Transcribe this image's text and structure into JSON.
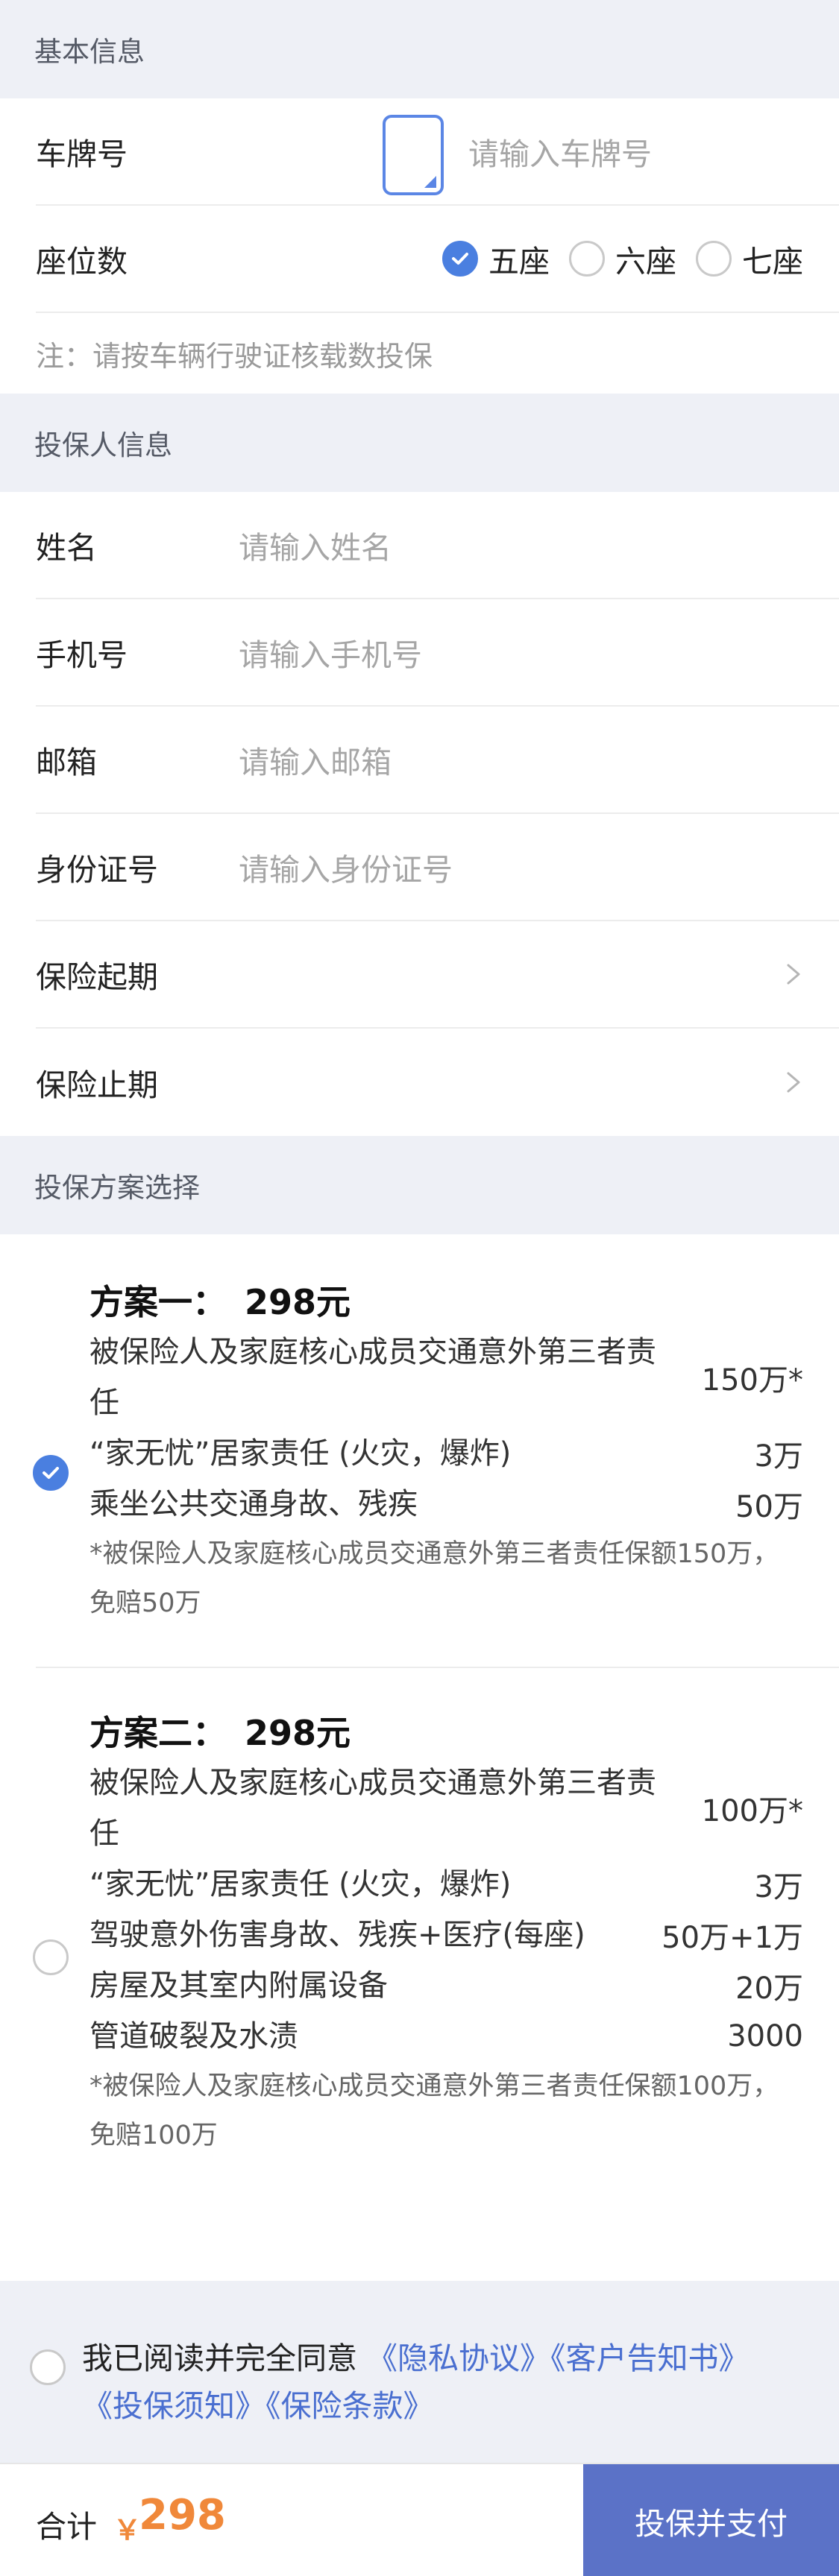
{
  "vehicle": {
    "section_title": "基本信息",
    "plate_label": "车牌号",
    "plate_placeholder": "请输入车牌号",
    "seat_label": "座位数",
    "seat_options": [
      "五座",
      "六座",
      "七座"
    ],
    "seat_selected": "五座",
    "note": "注：请按车辆行驶证核载数投保"
  },
  "applicant": {
    "section_title": "投保人信息",
    "fields": [
      {
        "label": "姓名",
        "placeholder": "请输入姓名"
      },
      {
        "label": "手机号",
        "placeholder": "请输入手机号"
      },
      {
        "label": "邮箱",
        "placeholder": "请输入邮箱"
      },
      {
        "label": "身份证号",
        "placeholder": "请输入身份证号"
      }
    ],
    "start_label": "保险起期",
    "end_label": "保险止期"
  },
  "plans": {
    "section_title": "投保方案选择",
    "selected": "方案一",
    "items": [
      {
        "title": "方案一：",
        "price": "298元",
        "coverages": [
          {
            "name": "被保险人及家庭核心成员交通意外第三者责任",
            "amount": "150万*"
          },
          {
            "name": "“家无忧”居家责任 (火灾，爆炸)",
            "amount": "3万"
          },
          {
            "name": "乘坐公共交通身故、残疾",
            "amount": "50万"
          }
        ],
        "note": "*被保险人及家庭核心成员交通意外第三者责任保额150万，免赔50万"
      },
      {
        "title": "方案二：",
        "price": "298元",
        "coverages": [
          {
            "name": "被保险人及家庭核心成员交通意外第三者责任",
            "amount": "100万*"
          },
          {
            "name": "“家无忧”居家责任 (火灾，爆炸)",
            "amount": "3万"
          },
          {
            "name": "驾驶意外伤害身故、残疾+医疗(每座)",
            "amount": "50万+1万"
          },
          {
            "name": "房屋及其室内附属设备",
            "amount": "20万"
          },
          {
            "name": "管道破裂及水渍",
            "amount": "3000"
          }
        ],
        "note": "*被保险人及家庭核心成员交通意外第三者责任保额100万，免赔100万"
      }
    ]
  },
  "agreement": {
    "prefix": "我已阅读并完全同意",
    "links": [
      "《隐私协议》",
      "《客户告知书》",
      "《投保须知》",
      "《保险条款》"
    ],
    "checked": false
  },
  "footer": {
    "total_label": "合计",
    "currency": "￥",
    "total": "298",
    "pay_button": "投保并支付"
  },
  "colors": {
    "accent": "#4a7fe0",
    "price": "#f0883a",
    "pay_button_bg": "#5b72c7",
    "section_bg": "#eef0f6"
  },
  "icons": [
    "checkmark-icon",
    "chevron-right-icon",
    "radio-empty-icon"
  ]
}
